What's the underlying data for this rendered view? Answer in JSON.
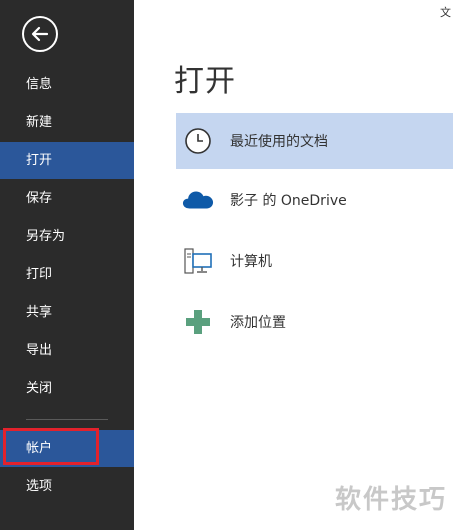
{
  "window": {
    "corner_text": "文"
  },
  "sidebar": {
    "back_icon": "back-arrow-icon",
    "items": [
      {
        "label": "信息",
        "active": false
      },
      {
        "label": "新建",
        "active": false
      },
      {
        "label": "打开",
        "active": true
      },
      {
        "label": "保存",
        "active": false
      },
      {
        "label": "另存为",
        "active": false
      },
      {
        "label": "打印",
        "active": false
      },
      {
        "label": "共享",
        "active": false
      },
      {
        "label": "导出",
        "active": false
      },
      {
        "label": "关闭",
        "active": false
      },
      {
        "label": "帐户",
        "active": false
      },
      {
        "label": "选项",
        "active": false
      }
    ],
    "colors": {
      "background": "#2b2b2b",
      "active": "#2b579a",
      "highlight": "#e3222c"
    }
  },
  "main": {
    "title": "打开",
    "locations": [
      {
        "label": "最近使用的文档",
        "icon": "clock-icon",
        "selected": true
      },
      {
        "label": "影子 的 OneDrive",
        "icon": "onedrive-cloud-icon",
        "selected": false
      },
      {
        "label": "计算机",
        "icon": "computer-icon",
        "selected": false
      },
      {
        "label": "添加位置",
        "icon": "plus-icon",
        "selected": false
      }
    ],
    "colors": {
      "selected": "#c5d6f0",
      "onedrive": "#0f5aa8",
      "plus": "#5aa07e"
    }
  },
  "watermark": "软件技巧"
}
